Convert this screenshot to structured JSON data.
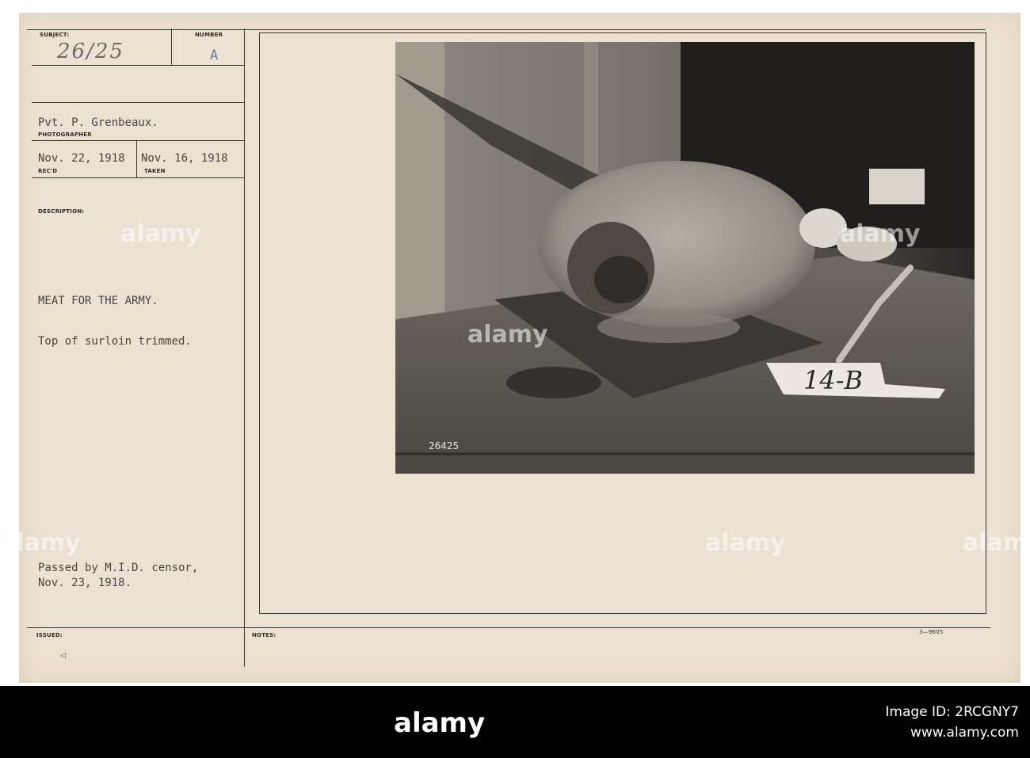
{
  "card": {
    "subject_label": "SUBJECT:",
    "subject_value": "26/25",
    "number_label": "NUMBER",
    "number_value": "A",
    "photographer_value": "Pvt. P. Grenbeaux.",
    "photographer_label": "PHOTOGRAPHER",
    "recd_value": "Nov. 22, 1918",
    "recd_label": "REC'D",
    "taken_value": "Nov. 16, 1918",
    "taken_label": "TAKEN",
    "description_label": "DESCRIPTION:",
    "description_line1": "MEAT FOR THE ARMY.",
    "description_line2": "Top of surloin trimmed.",
    "censor_line1": "Passed by M.I.D. censor,",
    "censor_line2": "Nov. 23, 1918.",
    "issued_label": "ISSUED:",
    "issued_mark": "◁",
    "notes_label": "NOTES:",
    "form_code": "3—9605"
  },
  "photo": {
    "label_card_text": "14-B",
    "negative_number": "26425"
  },
  "watermark": {
    "text": "alamy"
  },
  "footer": {
    "logo_text": "alamy",
    "image_id": "Image ID: 2RCGNY7",
    "url": "www.alamy.com"
  },
  "colors": {
    "card_background": "#ece2d3",
    "rule_lines": "#3a3632",
    "footer_background": "#000000"
  }
}
